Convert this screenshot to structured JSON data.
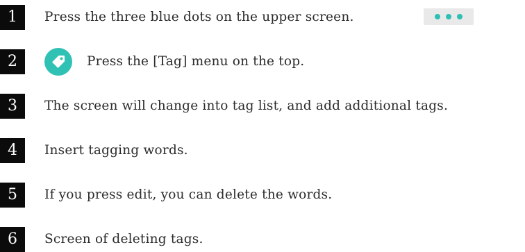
{
  "steps": [
    {
      "number": "1",
      "text": "Press the three blue dots on the upper screen."
    },
    {
      "number": "2",
      "text": "Press the [Tag] menu on the top."
    },
    {
      "number": "3",
      "text": "The screen will change into tag list, and add additional tags."
    },
    {
      "number": "4",
      "text": "Insert tagging words."
    },
    {
      "number": "5",
      "text": "If you press edit, you can delete the words."
    },
    {
      "number": "6",
      "text": "Screen of deleting tags."
    }
  ],
  "icons": {
    "more": "three-dots-icon",
    "tag": "tag-icon"
  },
  "colors": {
    "accent": "#2fc1b4",
    "badge_bg": "#0b0b0b",
    "text": "#2b2b2b"
  }
}
